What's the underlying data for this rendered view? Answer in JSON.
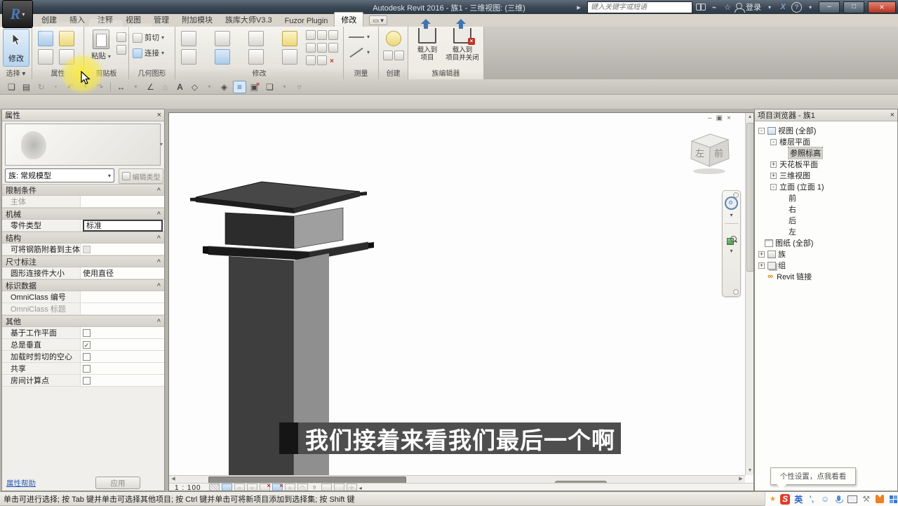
{
  "colors": {
    "titlebar_top": "#5f6d7b",
    "titlebar_bottom": "#2c3845",
    "ribbon_bg": "#e9e7e0",
    "accent_blue": "#3f74b5",
    "subtitle_bg": "#4e4e4e",
    "subtitle_edge": "#151515",
    "highlight_yellow": "#faeb3c",
    "link_blue": "#2f5fb3",
    "sogou_red": "#e23c28",
    "close_red": "#b5321f",
    "selection_grey": "#d2d0cb"
  },
  "title_bar": {
    "app_title": "Autodesk Revit 2016 -    族1 - 三维视图: (三维)",
    "search_placeholder": "键入关键字或短语",
    "login_label": "登录",
    "exchange_label": "X",
    "help_label": "?",
    "minimize": "–",
    "maximize": "□",
    "close": "×"
  },
  "ribbon": {
    "tabs": [
      "创建",
      "插入",
      "注释",
      "视图",
      "管理",
      "附加模块",
      "族库大师V3.3",
      "Fuzor Plugin",
      "修改"
    ],
    "active_tab": "修改",
    "panels": {
      "select": {
        "label": "选择 ▾",
        "modify_button": "修改"
      },
      "properties": {
        "label": "属性"
      },
      "clipboard": {
        "label": "剪贴板",
        "paste": "粘贴"
      },
      "geometry": {
        "label": "几何图形",
        "cut": "剪切",
        "join": "连接"
      },
      "modify": {
        "label": "修改"
      },
      "measure": {
        "label": "测量"
      },
      "create": {
        "label": "创建"
      },
      "family_editor": {
        "label": "族编辑器",
        "load": "载入到\n项目",
        "load_close": "载入到\n项目并关闭"
      }
    }
  },
  "properties_panel": {
    "title": "属性",
    "type_selector": "族: 常规模型",
    "edit_type": "编辑类型",
    "sections": [
      {
        "header": "限制条件",
        "rows": [
          {
            "label": "主体",
            "value": ""
          }
        ]
      },
      {
        "header": "机械",
        "rows": [
          {
            "label": "零件类型",
            "value": "标准"
          }
        ]
      },
      {
        "header": "结构",
        "rows": [
          {
            "label": "可将钢筋附着到主体",
            "check": ""
          }
        ]
      },
      {
        "header": "尺寸标注",
        "rows": [
          {
            "label": "圆形连接件大小",
            "value": "使用直径"
          }
        ]
      },
      {
        "header": "标识数据",
        "rows": [
          {
            "label": "OmniClass 编号",
            "value": ""
          },
          {
            "label": "OmniClass 标题",
            "value": ""
          }
        ]
      },
      {
        "header": "其他",
        "rows": [
          {
            "label": "基于工作平面",
            "check": ""
          },
          {
            "label": "总是垂直",
            "check": "✓"
          },
          {
            "label": "加载时剪切的空心",
            "check": ""
          },
          {
            "label": "共享",
            "check": ""
          },
          {
            "label": "房间计算点",
            "check": ""
          }
        ]
      }
    ],
    "footer": {
      "help": "属性帮助",
      "apply": "应用"
    }
  },
  "project_browser": {
    "title": "项目浏览器 - 族1",
    "items": [
      {
        "exp": "-",
        "label": "视图 (全部)"
      },
      {
        "exp": "-",
        "label": "楼层平面"
      },
      {
        "exp": "",
        "label": "参照标高"
      },
      {
        "exp": "+",
        "label": "天花板平面"
      },
      {
        "exp": "+",
        "label": "三维视图"
      },
      {
        "exp": "-",
        "label": "立面 (立面 1)"
      },
      {
        "exp": "",
        "label": "前"
      },
      {
        "exp": "",
        "label": "右"
      },
      {
        "exp": "",
        "label": "后"
      },
      {
        "exp": "",
        "label": "左"
      },
      {
        "exp": "",
        "label": "图纸 (全部)"
      },
      {
        "exp": "+",
        "label": "族"
      },
      {
        "exp": "+",
        "label": "组"
      },
      {
        "exp": "",
        "label": "Revit 链接"
      }
    ]
  },
  "canvas": {
    "view_scale": "1 : 100",
    "viewcube": {
      "left": "左",
      "front": "前"
    },
    "window_controls": {
      "minimize": "–",
      "restore": "▣",
      "close": "×"
    },
    "link_glyph": "∞"
  },
  "subtitle": {
    "text": "我们接着来看我们最后一个啊"
  },
  "status_bar": {
    "hint": "单击可进行选择; 按 Tab 键并单击可选择其他项目; 按 Ctrl 键并单击可将新项目添加到选择集; 按 Shift 键"
  },
  "tooltip": {
    "text": "个性设置，点我看看"
  },
  "ime_bar": {
    "logo": "S",
    "lang": "英"
  }
}
